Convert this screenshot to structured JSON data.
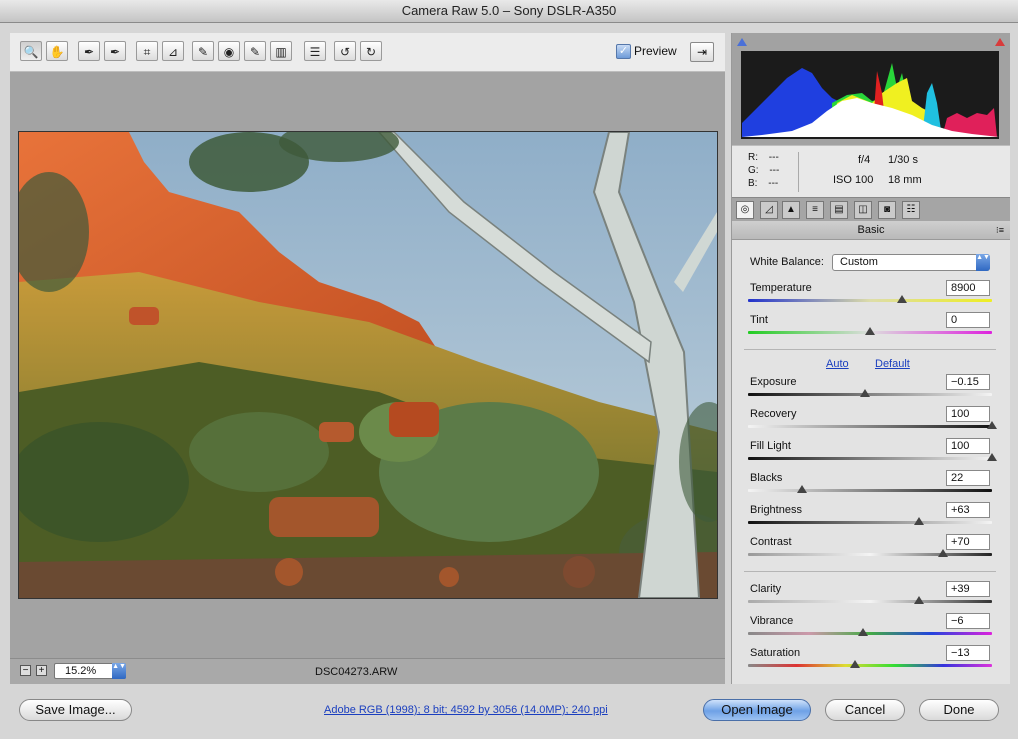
{
  "window": {
    "title": "Camera Raw 5.0  –  Sony DSLR-A350"
  },
  "toolbar": {
    "tools": [
      {
        "name": "zoom-tool-icon",
        "glyph": "🔍"
      },
      {
        "name": "hand-tool-icon",
        "glyph": "✋"
      },
      {
        "name": "white-balance-tool-icon",
        "glyph": "✒"
      },
      {
        "name": "color-sampler-tool-icon",
        "glyph": "✒"
      },
      {
        "name": "crop-tool-icon",
        "glyph": "⌗"
      },
      {
        "name": "straighten-tool-icon",
        "glyph": "⊿"
      },
      {
        "name": "spot-removal-tool-icon",
        "glyph": "✎"
      },
      {
        "name": "red-eye-tool-icon",
        "glyph": "◉"
      },
      {
        "name": "adjustment-brush-icon",
        "glyph": "✎"
      },
      {
        "name": "graduated-filter-icon",
        "glyph": "▥"
      },
      {
        "name": "preferences-icon",
        "glyph": "☰"
      },
      {
        "name": "rotate-ccw-icon",
        "glyph": "↺"
      },
      {
        "name": "rotate-cw-icon",
        "glyph": "↻"
      }
    ],
    "preview_label": "Preview",
    "preview_checked": "✓",
    "fullscreen_glyph": "⇥"
  },
  "status": {
    "zoom_minus": "−",
    "zoom_plus": "+",
    "zoom_value": "15.2%",
    "select_arrows": "▲▼",
    "filename": "DSC04273.ARW"
  },
  "info": {
    "r_label": "R:",
    "r_value": "---",
    "g_label": "G:",
    "g_value": "---",
    "b_label": "B:",
    "b_value": "---",
    "aperture": "f/4",
    "shutter": "1/30 s",
    "iso": "ISO 100",
    "focal_length": "18 mm"
  },
  "panel": {
    "section_title": "Basic",
    "menu_glyph": "⁝≡",
    "white_balance_label": "White Balance:",
    "white_balance_value": "Custom",
    "auto_label": "Auto",
    "default_label": "Default",
    "controls": [
      {
        "label": "Temperature",
        "value": "8900",
        "level": 0.63
      },
      {
        "label": "Tint",
        "value": "0",
        "level": 0.5
      },
      {
        "label": "Exposure",
        "value": "−0.15",
        "level": 0.48
      },
      {
        "label": "Recovery",
        "value": "100",
        "level": 1.0
      },
      {
        "label": "Fill Light",
        "value": "100",
        "level": 1.0
      },
      {
        "label": "Blacks",
        "value": "22",
        "level": 0.22
      },
      {
        "label": "Brightness",
        "value": "+63",
        "level": 0.7
      },
      {
        "label": "Contrast",
        "value": "+70",
        "level": 0.8
      },
      {
        "label": "Clarity",
        "value": "+39",
        "level": 0.7
      },
      {
        "label": "Vibrance",
        "value": "−6",
        "level": 0.47
      },
      {
        "label": "Saturation",
        "value": "−13",
        "level": 0.44
      }
    ]
  },
  "bottom": {
    "save_label": "Save Image...",
    "workflow_info": "Adobe RGB (1998); 8 bit; 4592 by 3056 (14.0MP); 240 ppi",
    "open_label": "Open Image",
    "cancel_label": "Cancel",
    "done_label": "Done"
  },
  "colors": {
    "accent": "#4a7fd4",
    "clip_shadow": "#4a70d8",
    "clip_highlight": "#d83a3a"
  }
}
